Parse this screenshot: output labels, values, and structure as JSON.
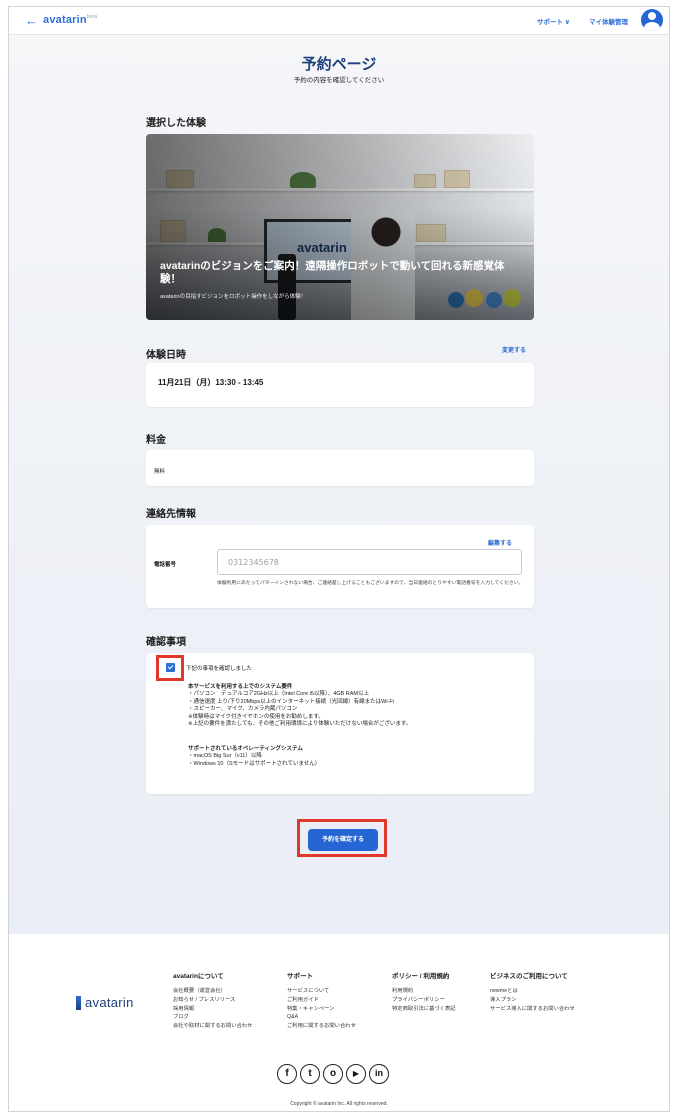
{
  "header": {
    "back": "←",
    "logo": "avatarin",
    "logo_badge": "beta",
    "nav": [
      "サポート ∨",
      "マイ体験管理"
    ]
  },
  "page": {
    "title": "予約ページ",
    "subtitle": "予約の内容を確認してください"
  },
  "experience": {
    "section": "選択した体験",
    "title": "avatarinのビジョンをご案内！遠隔操作ロボットで動いて回れる新感覚体験！",
    "subtitle": "avatarinの目指すビジョンをロボット操作をしながら体験！",
    "screen_logo": "avatarin"
  },
  "datetime": {
    "section": "体験日時",
    "change": "変更する",
    "value": "11月21日（月）13:30 - 13:45"
  },
  "fee": {
    "section": "料金",
    "value": "無料"
  },
  "contact": {
    "section": "連絡先情報",
    "edit": "編集する",
    "phone_label": "電話番号",
    "phone_placeholder": "0312345678",
    "note": "体験利用にあたってパターインされない場合、ご連絡差し上げることもございますので、当日連絡のとりやすい電話番号を入力してください。"
  },
  "confirm": {
    "section": "確認事項",
    "checkbox_label": "下記の事項を確認しました",
    "checked": true,
    "req_title": "本サービスを利用する上でのシステム要件",
    "req_lines": [
      "・パソコン　デュアルコア2GHz以上（Intel Core i5以降）、4GB RAM以上",
      "・通信速度 上り/下り20Mbps以上のインターネット接続（光回線）有線またはWi-Fi",
      "・スピーカー、マイク、カメラ内蔵パソコン",
      "※体験時はマイク付きイヤホンの使用をお勧めします。",
      "※上記の要件を満たしても、その他ご利用環境により体験いただけない場合がございます。"
    ],
    "os_title": "サポートされているオペレーティングシステム",
    "os_lines": [
      "・macOS Big Sur（v11）以降",
      "・Windows 10（Sモードはサポートされていません）"
    ],
    "button": "予約を確定する"
  },
  "footer": {
    "logo": "avatarin",
    "columns": [
      {
        "heading": "avatarinについて",
        "items": [
          "会社概要（運営会社）",
          "お知らせ / プレスリリース",
          "採用情報",
          "ブログ",
          "会社や取材に関するお問い合わせ"
        ]
      },
      {
        "heading": "サポート",
        "items": [
          "サービスについて",
          "ご利用ガイド",
          "特集・キャンペーン",
          "Q&A",
          "ご利用に関するお問い合わせ"
        ]
      },
      {
        "heading": "ポリシー / 利用規約",
        "items": [
          "利用規約",
          "プライバシーポリシー",
          "特定商取引法に基づく表記"
        ]
      },
      {
        "heading": "ビジネスのご利用について",
        "items": [
          "newmeとは",
          "導入プラン",
          "サービス導入に関するお問い合わせ"
        ]
      }
    ],
    "social": [
      "f",
      "t",
      "o",
      "▶",
      "in"
    ],
    "copyright": "Copyright © avatarin Inc. All rights reserved."
  },
  "colors": {
    "accent": "#2566d4",
    "highlight": "#e0382a",
    "heading": "#1d3f7a"
  }
}
